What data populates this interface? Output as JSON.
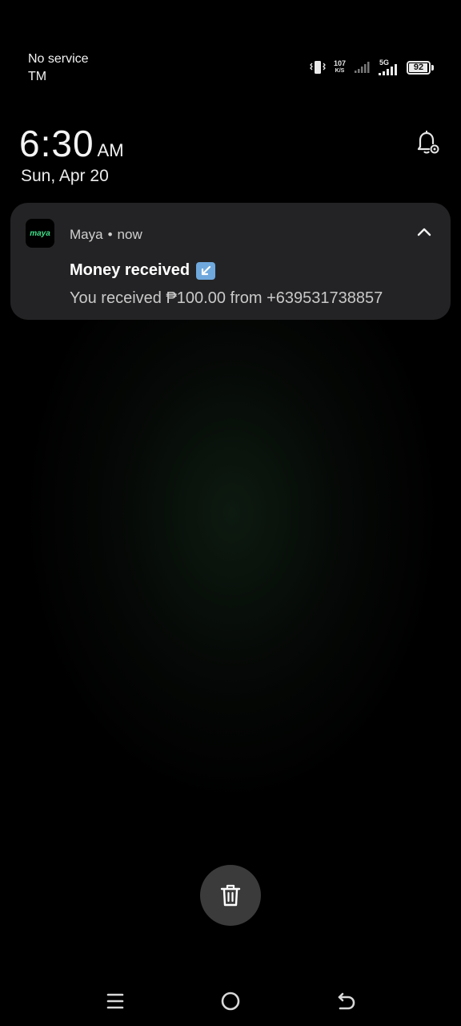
{
  "status_bar": {
    "carrier_line1": "No service",
    "carrier_line2": "TM",
    "speed_value": "107",
    "speed_unit": "K/S",
    "network_type": "5G",
    "battery_level": "92"
  },
  "lockscreen": {
    "time": "6:30",
    "ampm": "AM",
    "date": "Sun, Apr 20"
  },
  "notification": {
    "app_icon_text": "maya",
    "app_name": "Maya",
    "separator": "•",
    "time": "now",
    "title": "Money received",
    "body": "You received ₱100.00 from +639531738857"
  },
  "colors": {
    "brand_green": "#3fe08a",
    "card_bg": "#232325",
    "emoji_blue": "#6fa8dc"
  },
  "icons": [
    "vibrate-icon",
    "signal-icon",
    "battery-icon",
    "notification-settings-icon",
    "collapse-chevron-icon",
    "arrow-down-left-icon",
    "trash-icon",
    "menu-icon",
    "home-icon",
    "back-icon"
  ]
}
